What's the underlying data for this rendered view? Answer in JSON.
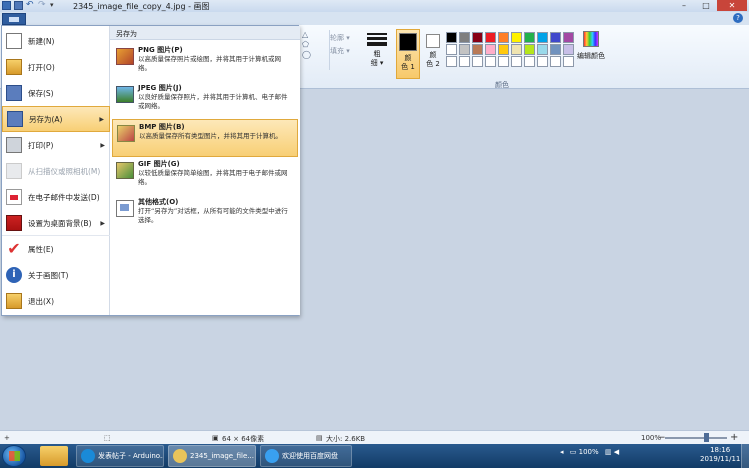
{
  "window": {
    "title": "2345_image_file_copy_4.jpg - 画图",
    "buttons": {
      "minimize": "–",
      "maximize": "□",
      "close": "✕"
    }
  },
  "ribbon": {
    "shapes": {
      "outline_label": "轮廓 ▾",
      "fill_label": "填充 ▾"
    },
    "size_label": "粗\n细 ▾",
    "color1_label": "颜\n色 1",
    "color2_label": "颜\n色 2",
    "color1": "#000000",
    "color2": "#ffffff",
    "edit_colors_label": "编辑颜色",
    "group_label": "颜色",
    "palette": [
      "#000000",
      "#7f7f7f",
      "#880015",
      "#ed1c24",
      "#ff7f27",
      "#fff200",
      "#22b14c",
      "#00a2e8",
      "#3f48cc",
      "#a349a4",
      "#ffffff",
      "#c3c3c3",
      "#b97a57",
      "#ffaec9",
      "#ffc90e",
      "#efe4b0",
      "#b5e61d",
      "#99d9ea",
      "#7092be",
      "#c8bfe7",
      "#ffffff",
      "#ffffff",
      "#ffffff",
      "#ffffff",
      "#ffffff",
      "#ffffff",
      "#ffffff",
      "#ffffff",
      "#ffffff",
      "#ffffff"
    ]
  },
  "file_menu": {
    "items": [
      {
        "label": "新建(N)",
        "icon": "new-file-icon"
      },
      {
        "label": "打开(O)",
        "icon": "open-folder-icon"
      },
      {
        "label": "保存(S)",
        "icon": "save-icon"
      },
      {
        "label": "另存为(A)",
        "icon": "save-as-icon",
        "submenu": true,
        "selected": true
      },
      {
        "label": "打印(P)",
        "icon": "print-icon",
        "submenu": true
      },
      {
        "label": "从扫描仪或照相机(M)",
        "icon": "scanner-icon",
        "disabled": true
      },
      {
        "label": "在电子邮件中发送(D)",
        "icon": "email-icon"
      },
      {
        "label": "设置为桌面背景(B)",
        "icon": "desktop-background-icon",
        "submenu": true
      },
      {
        "label": "属性(E)",
        "icon": "properties-check-icon"
      },
      {
        "label": "关于画图(T)",
        "icon": "about-info-icon"
      },
      {
        "label": "退出(X)",
        "icon": "exit-icon"
      }
    ],
    "submenu": {
      "header": "另存为",
      "items": [
        {
          "title": "PNG 图片(P)",
          "desc": "以高质量保存照片或绘图，并将其用于计算机或网络。",
          "icon": "png-image-icon"
        },
        {
          "title": "JPEG 图片(J)",
          "desc": "以良好质量保存照片，并将其用于计算机、电子邮件或网络。",
          "icon": "jpeg-image-icon"
        },
        {
          "title": "BMP 图片(B)",
          "desc": "以高质量保存所有类型图片，并将其用于计算机。",
          "icon": "bmp-image-icon",
          "selected": true
        },
        {
          "title": "GIF 图片(G)",
          "desc": "以较低质量保存简单绘图，并将其用于电子邮件或网络。",
          "icon": "gif-image-icon"
        },
        {
          "title": "其他格式(O)",
          "desc": "打开“另存为”对话框，从所有可能的文件类型中进行选择。",
          "icon": "other-formats-icon"
        }
      ]
    }
  },
  "statusbar": {
    "dimensions": "64 × 64像素",
    "size": "大小: 2.6KB",
    "zoom": "100%",
    "zoom_level": 1.0
  },
  "taskbar": {
    "buttons": [
      {
        "label": "发表帖子 - Arduino..."
      },
      {
        "label": "2345_image_file..."
      },
      {
        "label": "欢迎使用百度网盘"
      }
    ],
    "tray_battery": "100%",
    "clock_time": "18:16",
    "clock_date": "2019/11/11"
  }
}
